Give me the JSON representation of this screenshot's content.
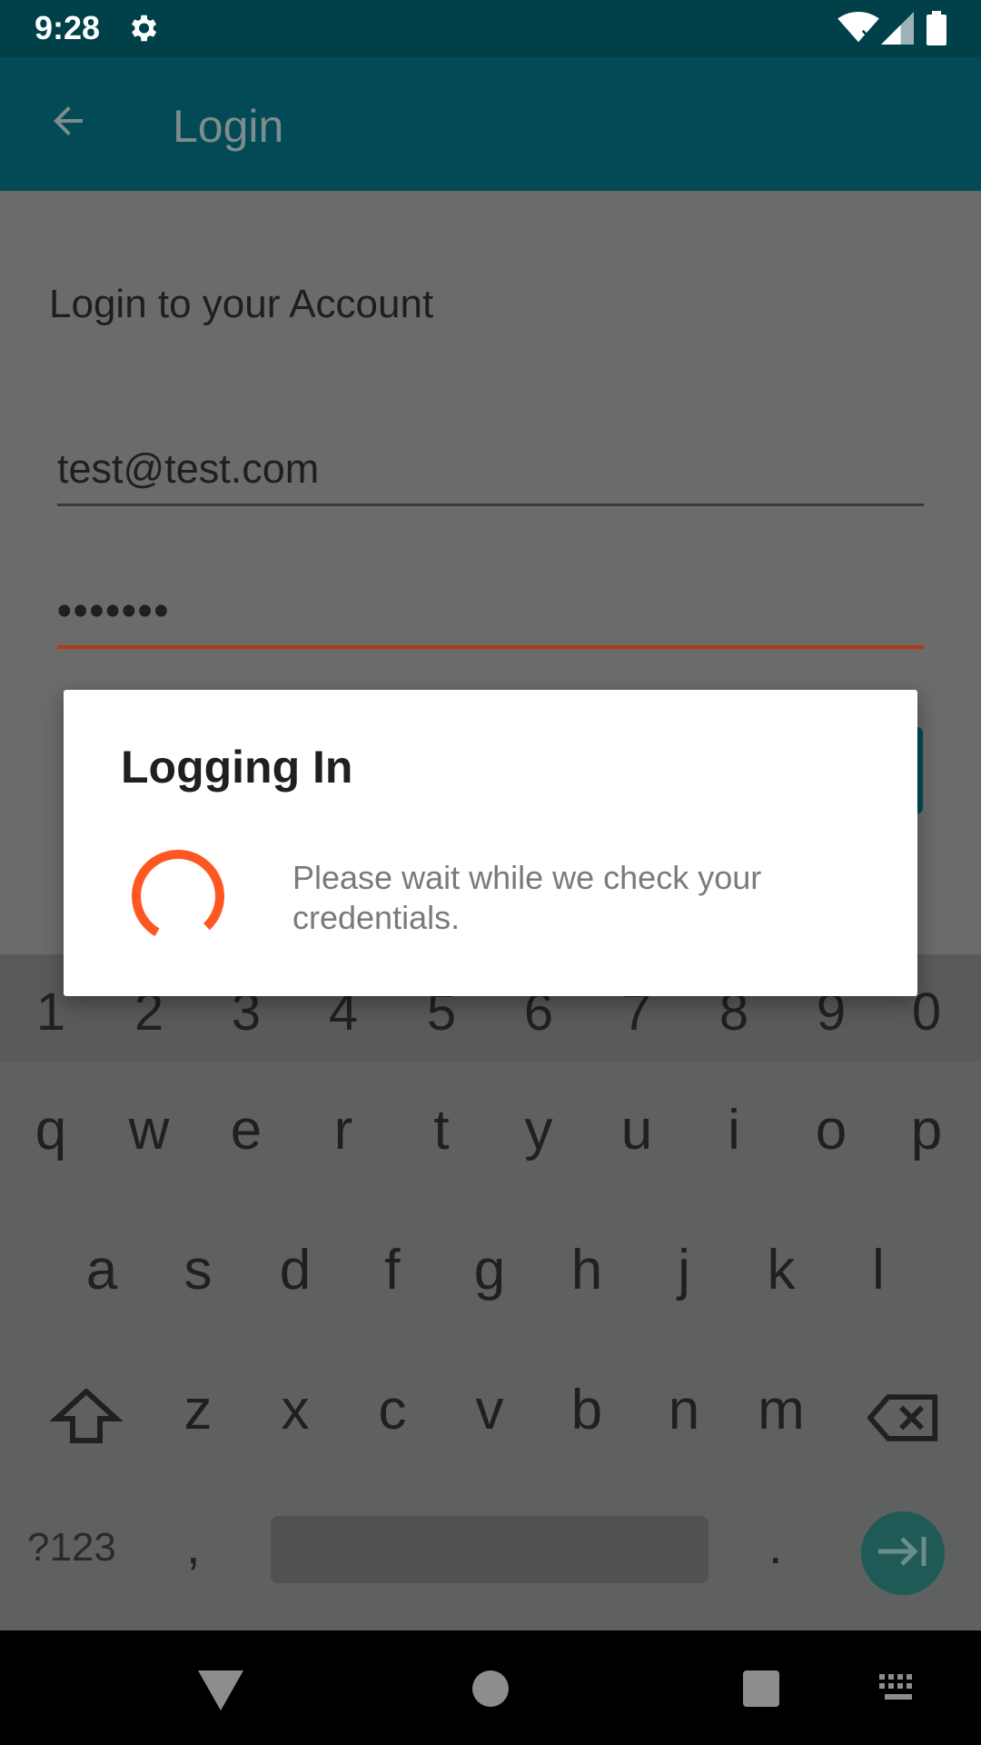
{
  "status_bar": {
    "time": "9:28",
    "icons": [
      "settings-icon",
      "wifi-icon",
      "signal-icon",
      "battery-icon"
    ]
  },
  "app_bar": {
    "back_icon": "arrow-back-icon",
    "title": "Login"
  },
  "main": {
    "heading": "Login to your Account",
    "email_value": "test@test.com",
    "password_value": "•••••••"
  },
  "dialog": {
    "title": "Logging In",
    "message": "Please wait while we check your credentials.",
    "spinner_icon": "loading-spinner-icon"
  },
  "keyboard": {
    "number_row": [
      "1",
      "2",
      "3",
      "4",
      "5",
      "6",
      "7",
      "8",
      "9",
      "0"
    ],
    "row1": [
      "q",
      "w",
      "e",
      "r",
      "t",
      "y",
      "u",
      "i",
      "o",
      "p"
    ],
    "row2": [
      "a",
      "s",
      "d",
      "f",
      "g",
      "h",
      "j",
      "k",
      "l"
    ],
    "row3": [
      "z",
      "x",
      "c",
      "v",
      "b",
      "n",
      "m"
    ],
    "symbols_label": "?123",
    "comma": ",",
    "period": ".",
    "icons": [
      "shift-icon",
      "backspace-icon",
      "next-field-icon"
    ]
  },
  "nav_bar": {
    "icons": [
      "nav-back-icon",
      "nav-home-icon",
      "nav-recents-icon",
      "keyboard-switch-icon"
    ]
  },
  "colors": {
    "app_bar": "#024b56",
    "status_bar": "#004049",
    "accent": "#ff5722",
    "scrim": "#6b6b6b"
  }
}
